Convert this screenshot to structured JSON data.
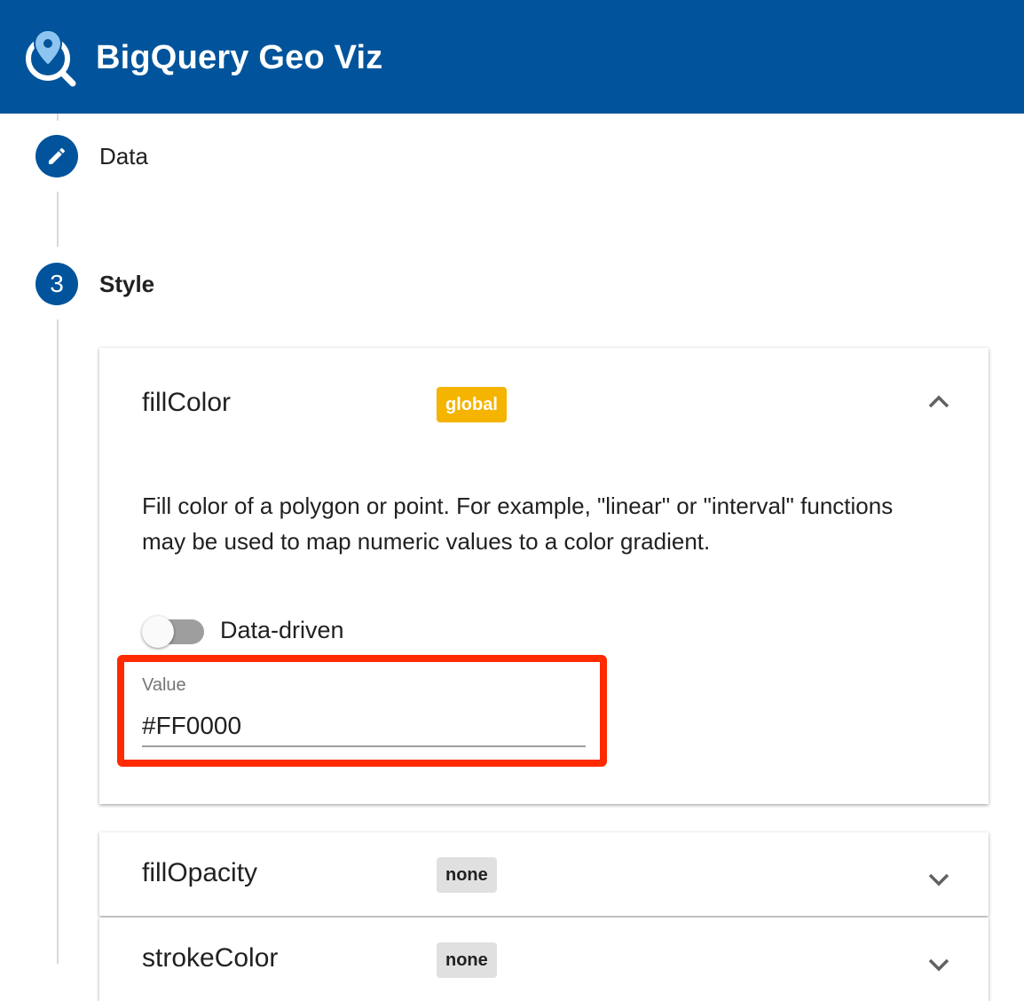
{
  "app": {
    "title": "BigQuery Geo Viz"
  },
  "steps": [
    {
      "label": "Data",
      "icon": "pencil-icon"
    },
    {
      "number": "3",
      "label": "Style"
    }
  ],
  "panels": [
    {
      "title": "fillColor",
      "badge": "global",
      "expanded": true,
      "description": "Fill color of a polygon or point. For example, \"linear\" or \"interval\" functions may be used to map numeric values to a color gradient.",
      "toggle_label": "Data-driven",
      "toggle_on": false,
      "value_label": "Value",
      "value": "#FF0000"
    },
    {
      "title": "fillOpacity",
      "badge": "none",
      "expanded": false
    },
    {
      "title": "strokeColor",
      "badge": "none",
      "expanded": false
    }
  ],
  "colors": {
    "appbar": "#01549b",
    "highlight_border": "#ff2a00",
    "badge_global": "#f4b400",
    "badge_none": "#e0e0e0"
  }
}
